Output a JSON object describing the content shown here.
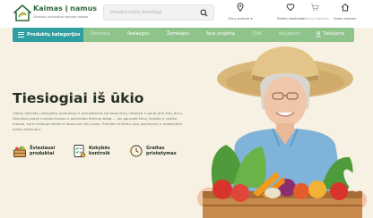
{
  "header": {
    "brand": "Kaimas į namus",
    "tagline": "Ūkininkų produktai vienoje vietoje",
    "search_placeholder": "Paieška mūsų kataloge",
    "items": [
      {
        "label": "Jūsų vietovė ▾",
        "icon": "location-pin-icon"
      },
      {
        "label": "Patikę skelbimai",
        "icon": "heart-icon"
      },
      {
        "label": "Pirkinių krepšelis",
        "icon": "cart-icon"
      },
      {
        "label": "Vieta visiems",
        "icon": "home-icon"
      }
    ]
  },
  "nav": {
    "categories_label": "Produktų kategorijos",
    "items": [
      "Ūkininkai",
      "Paslaugos",
      "Žemėlapis",
      "Apie projektą",
      "DUK",
      "Naujienos"
    ],
    "user_label": "Tiekėjams"
  },
  "hero": {
    "title": "Tiesiogiai iš ūkio",
    "description": "Vietos ūkininkų užauginta produkcija ir paruoštomis be tarpininkų užsakyti ir gauti prie jūsų durų. Ūkininkai patys nustato kainas ir pasirenka tiekimo būdą — jūs gaunate tikrą, šviežią ir sveiką maistą, kuris keliauja tiesiai iš lauko ant jūsų stalo. Rinkitės iš šimtų ūkių pasiūlymų ir palaikykite vietos ūkininkus.",
    "features": [
      {
        "label": "Švieziausi\nproduktai",
        "icon": "fresh-products-icon"
      },
      {
        "label": "Kokybės\nkontrolė",
        "icon": "quality-control-icon"
      },
      {
        "label": "Greitas\npristatymas",
        "icon": "fast-delivery-icon"
      }
    ]
  },
  "colors": {
    "brand_green": "#2f6b3a",
    "nav_green": "#8fc38c",
    "nav_teal": "#2e9fa1",
    "background": "#f7f1e3"
  }
}
